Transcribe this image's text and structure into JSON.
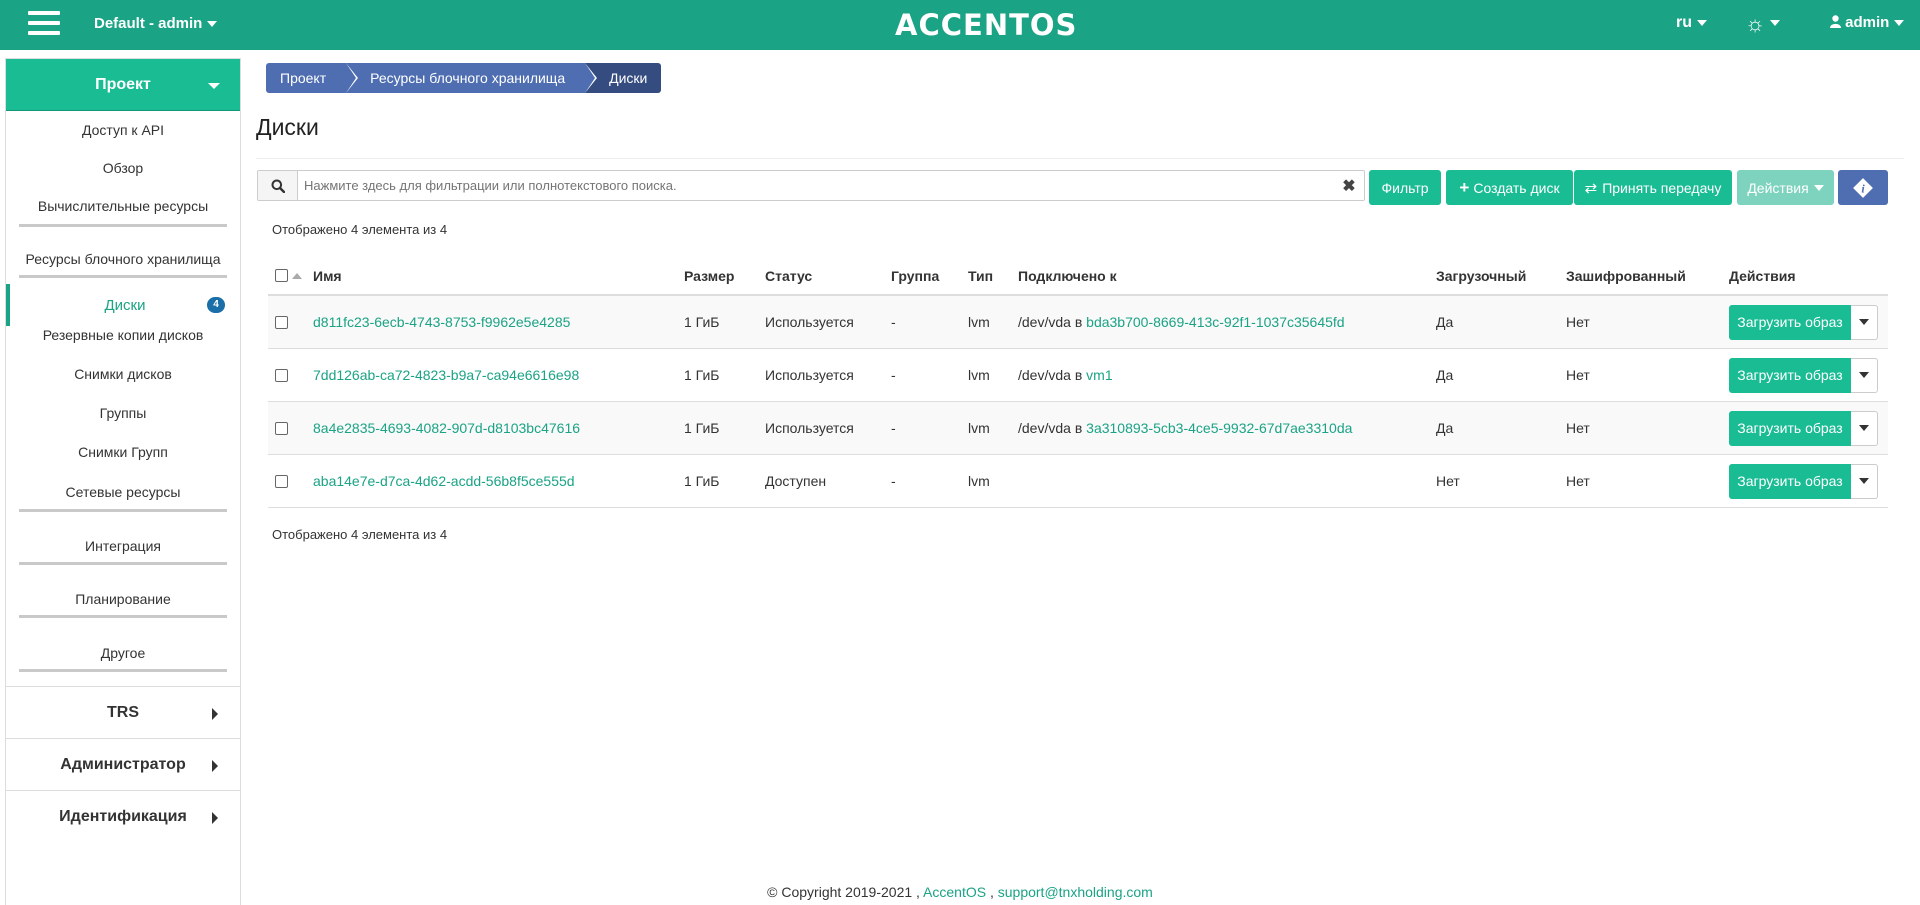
{
  "topbar": {
    "project_selector": "Default - admin",
    "logo": "ACCENTOS",
    "language": "ru",
    "user": "admin",
    "color": "#1aa385"
  },
  "sidebar": {
    "project": "Проект",
    "links": [
      "Доступ к API",
      "Обзор"
    ],
    "compute": "Вычислительные ресурсы",
    "block_storage": "Ресурсы блочного хранилища",
    "active_item": "Диски",
    "active_badge": "4",
    "storage_items": [
      "Резервные копии дисков",
      "Снимки дисков",
      "Группы",
      "Снимки Групп"
    ],
    "groups": [
      "Сетевые ресурсы",
      "Интеграция",
      "Планирование",
      "Другое"
    ],
    "sections": [
      "TRS",
      "Администратор",
      "Идентификация"
    ]
  },
  "breadcrumb": [
    "Проект",
    "Ресурсы блочного хранилища",
    "Диски"
  ],
  "page_title": "Диски",
  "search": {
    "placeholder": "Нажмите здесь для фильтрации или полнотекстового поиска."
  },
  "toolbar": {
    "filter": "Фильтр",
    "create": "Создать диск",
    "accept_transfer": "Принять передачу",
    "actions": "Действия"
  },
  "count_text": "Отображено 4 элемента из 4",
  "table": {
    "headers": [
      "Имя",
      "Размер",
      "Статус",
      "Группа",
      "Тип",
      "Подключено к",
      "Загрузочный",
      "Зашифрованный",
      "Действия"
    ],
    "rows": [
      {
        "name": "d811fc23-6ecb-4743-8753-f9962e5e4285",
        "size": "1 ГиБ",
        "status": "Используется",
        "group": "-",
        "type": "lvm",
        "attach_prefix": "/dev/vda в",
        "attach_link": "bda3b700-8669-413c-92f1-1037c35645fd",
        "bootable": "Да",
        "encrypted": "Нет",
        "action": "Загрузить образ"
      },
      {
        "name": "7dd126ab-ca72-4823-b9a7-ca94e6616e98",
        "size": "1 ГиБ",
        "status": "Используется",
        "group": "-",
        "type": "lvm",
        "attach_prefix": "/dev/vda в",
        "attach_link": "vm1",
        "bootable": "Да",
        "encrypted": "Нет",
        "action": "Загрузить образ"
      },
      {
        "name": "8a4e2835-4693-4082-907d-d8103bc47616",
        "size": "1 ГиБ",
        "status": "Используется",
        "group": "-",
        "type": "lvm",
        "attach_prefix": "/dev/vda в",
        "attach_link": "3a310893-5cb3-4ce5-9932-67d7ae3310da",
        "bootable": "Да",
        "encrypted": "Нет",
        "action": "Загрузить образ"
      },
      {
        "name": "aba14e7e-d7ca-4d62-acdd-56b8f5ce555d",
        "size": "1 ГиБ",
        "status": "Доступен",
        "group": "-",
        "type": "lvm",
        "attach_prefix": "",
        "attach_link": "",
        "bootable": "Нет",
        "encrypted": "Нет",
        "action": "Загрузить образ"
      }
    ]
  },
  "footer": {
    "copyright": "© Copyright 2019-2021 ,",
    "link1": "AccentOS",
    "sep": ",",
    "link2": "support@tnxholding.com"
  }
}
